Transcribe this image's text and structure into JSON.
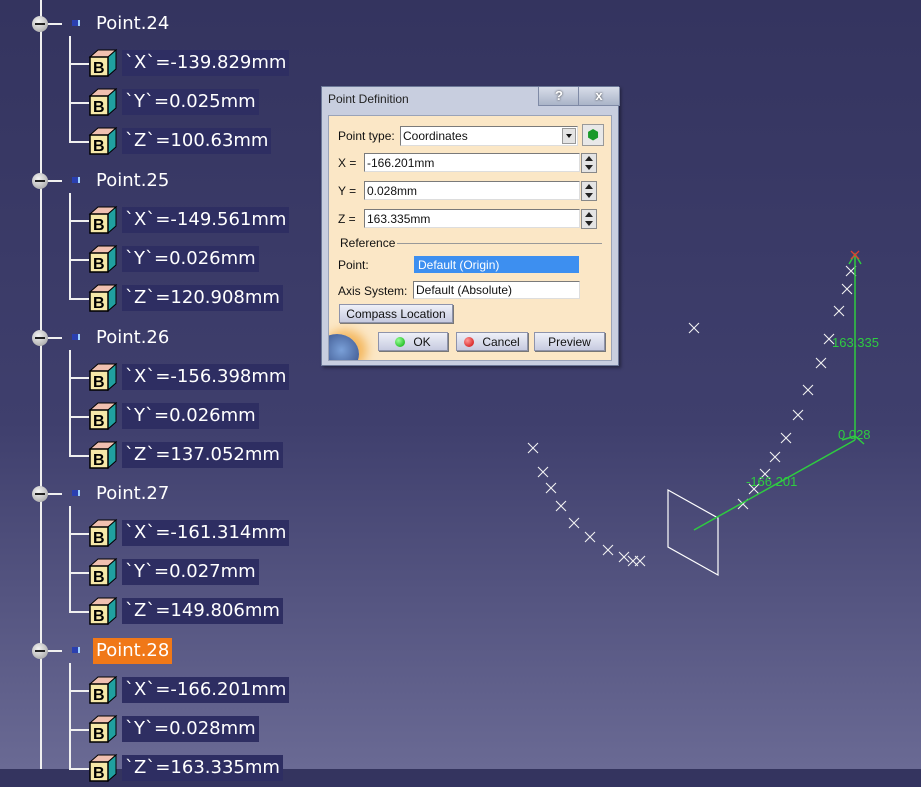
{
  "tree": {
    "points": [
      {
        "name": "Point.24",
        "x": "`X`=-139.829mm",
        "y": "`Y`=0.025mm",
        "z": "`Z`=100.63mm",
        "selected": false
      },
      {
        "name": "Point.25",
        "x": "`X`=-149.561mm",
        "y": "`Y`=0.026mm",
        "z": "`Z`=120.908mm",
        "selected": false
      },
      {
        "name": "Point.26",
        "x": "`X`=-156.398mm",
        "y": "`Y`=0.026mm",
        "z": "`Z`=137.052mm",
        "selected": false
      },
      {
        "name": "Point.27",
        "x": "`X`=-161.314mm",
        "y": "`Y`=0.027mm",
        "z": "`Z`=149.806mm",
        "selected": false
      },
      {
        "name": "Point.28",
        "x": "`X`=-166.201mm",
        "y": "`Y`=0.028mm",
        "z": "`Z`=163.335mm",
        "selected": true
      }
    ],
    "selected_color": "#f07818"
  },
  "dialog": {
    "title": "Point Definition",
    "help": "?",
    "close": "x",
    "point_type_label": "Point type:",
    "point_type_value": "Coordinates",
    "x_label": "X =",
    "x_value": "-166.201mm",
    "y_label": "Y =",
    "y_value": "0.028mm",
    "z_label": "Z =",
    "z_value": "163.335mm",
    "reference_label": "Reference",
    "point_label": "Point:",
    "point_value": "Default (Origin)",
    "axis_label": "Axis System:",
    "axis_value": "Default (Absolute)",
    "compass_button": "Compass Location",
    "ok_button": "OK",
    "cancel_button": "Cancel",
    "preview_button": "Preview"
  },
  "viewport": {
    "z_dimension": "163.335",
    "y_dimension": "0.028",
    "x_dimension": "-166.201",
    "manipulator_color": "#2ecc40"
  }
}
